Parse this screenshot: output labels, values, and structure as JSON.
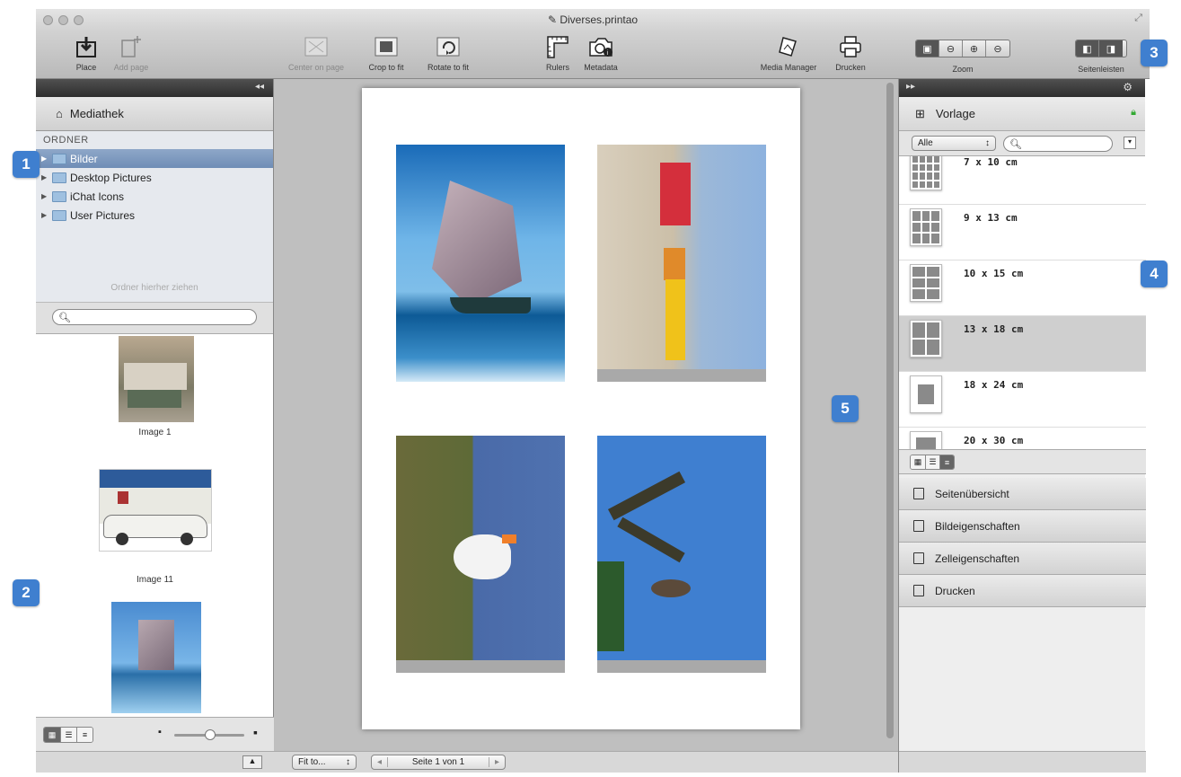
{
  "window": {
    "title": "Diverses.printao"
  },
  "toolbar": {
    "place": "Place",
    "add_page": "Add page",
    "center_on_page": "Center on page",
    "crop_to_fit": "Crop to fit",
    "rotate_to_fit": "Rotate to fit",
    "rulers": "Rulers",
    "metadata": "Metadata",
    "media_manager": "Media Manager",
    "drucken": "Drucken",
    "zoom": "Zoom",
    "seitenleisten": "Seitenleisten"
  },
  "left": {
    "library_title": "Mediathek",
    "folders_header": "ORDNER",
    "folders": [
      {
        "label": "Bilder"
      },
      {
        "label": "Desktop Pictures"
      },
      {
        "label": "iChat Icons"
      },
      {
        "label": "User Pictures"
      }
    ],
    "drop_hint": "Ordner hierher ziehen",
    "thumbs": [
      {
        "caption": "Image 1"
      },
      {
        "caption": "Image 11"
      }
    ]
  },
  "canvas": {
    "fit_label": "Fit to...",
    "page_label": "Seite 1 von 1"
  },
  "right": {
    "vorlage_title": "Vorlage",
    "filter_value": "Alle",
    "templates": [
      {
        "label": "7 x 10 cm"
      },
      {
        "label": "9 x 13 cm"
      },
      {
        "label": "10 x 15 cm"
      },
      {
        "label": "13 x 18 cm"
      },
      {
        "label": "18 x 24 cm"
      },
      {
        "label": "20 x 30 cm"
      }
    ],
    "sections": [
      {
        "label": "Seitenübersicht"
      },
      {
        "label": "Bildeigenschaften"
      },
      {
        "label": "Zelleigenschaften"
      },
      {
        "label": "Drucken"
      }
    ]
  },
  "badges": [
    "1",
    "2",
    "3",
    "4",
    "5"
  ],
  "colors": {
    "badge": "#3f7fcf",
    "selection": "#7a96bf"
  }
}
